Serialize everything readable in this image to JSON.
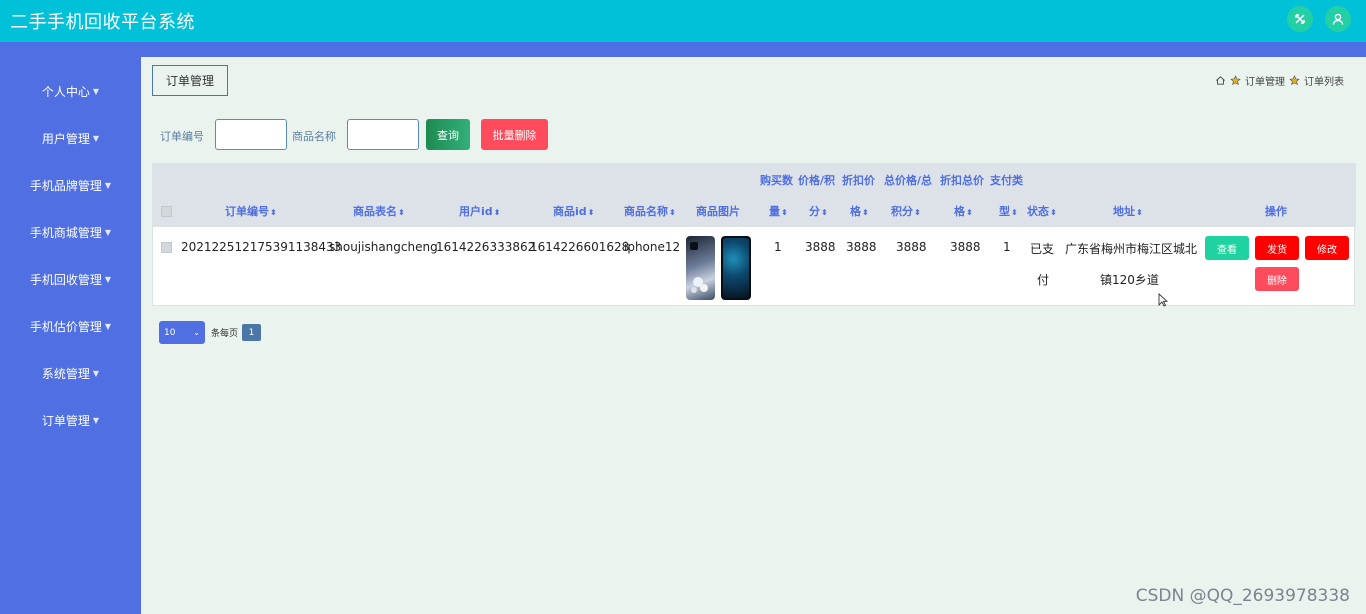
{
  "app": {
    "title": "二手手机回收平台系统"
  },
  "header": {
    "icons": [
      "swap-icon",
      "user-icon"
    ]
  },
  "sidebar": {
    "items": [
      {
        "label": "个人中心"
      },
      {
        "label": "用户管理"
      },
      {
        "label": "手机品牌管理"
      },
      {
        "label": "手机商城管理"
      },
      {
        "label": "手机回收管理"
      },
      {
        "label": "手机估价管理"
      },
      {
        "label": "系统管理"
      },
      {
        "label": "订单管理"
      }
    ]
  },
  "page": {
    "section_button": "订单管理",
    "breadcrumb": [
      "订单管理",
      "订单列表"
    ]
  },
  "search": {
    "order_no_label": "订单编号",
    "product_name_label": "商品名称",
    "query_label": "查询",
    "batch_delete_label": "批量删除"
  },
  "table": {
    "headers": {
      "order_no": "订单编号",
      "table_name": "商品表名",
      "user_id": "用户id",
      "product_id": "商品id",
      "product_name": "商品名称",
      "product_image": "商品图片",
      "qty_top": "购买数",
      "qty_bot": "量",
      "price_top": "价格/积",
      "price_bot": "分",
      "discount_top": "折扣价",
      "discount_bot": "格",
      "total_top": "总价格/总",
      "total_bot": "积分",
      "discount_total_top": "折扣总价",
      "discount_total_bot": "格",
      "pay_type_top": "支付类",
      "pay_type_bot": "型",
      "status": "状态",
      "address": "地址",
      "actions": "操作"
    },
    "rows": [
      {
        "order_no": "20212251217539113843​3",
        "table_name": "shoujishangcheng",
        "user_id": "1614226333862",
        "product_id": "1614226601628",
        "product_name": "iphone12",
        "quantity": "1",
        "price": "3888",
        "discount_price": "3888",
        "total_price": "3888",
        "discount_total": "3888",
        "pay_type": "1",
        "status_line1": "已支",
        "status_line2": "付",
        "address_line1": "广东省梅州市梅江区城北",
        "address_line2": "镇120乡道",
        "actions": {
          "view": "查看",
          "ship": "发货",
          "edit": "修改",
          "delete": "删除"
        }
      }
    ]
  },
  "pagination": {
    "page_size": "10",
    "per_page_label": "条每页",
    "current_page": "1"
  },
  "watermark": "CSDN @QQ_2693978338",
  "colors": {
    "header": "#00c1d7",
    "sidebar": "#4f6fe3",
    "view_button": "#1ed3a0",
    "ship_button": "#ff0000",
    "delete_button": "#ff4b5c"
  }
}
